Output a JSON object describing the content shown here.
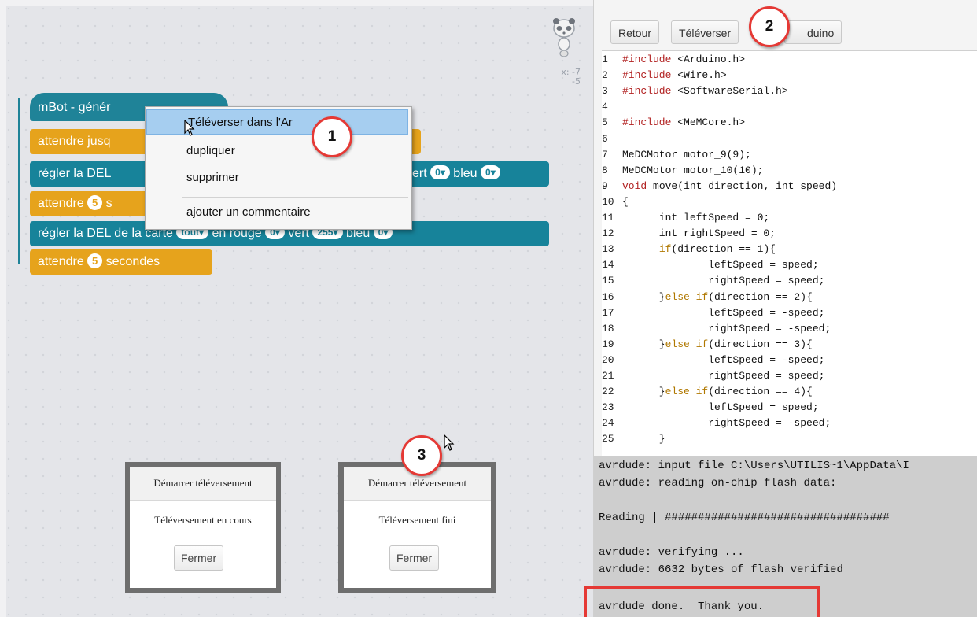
{
  "script_area": {
    "panda_icon": "panda-sprite",
    "coords": {
      "x": "x: -7",
      "y": "-5"
    },
    "blocks": {
      "hat": "mBot - génér",
      "hat_rest": "",
      "wait_until": "attendre jusq",
      "led1_prefix": "régler la DEL",
      "led1_green_label": "vert",
      "led1_green": "0",
      "led1_blue_label": "bleu",
      "led1_blue": "0",
      "wait1_prefix": "attendre",
      "wait1_num": "5",
      "wait1_suffix": "s",
      "led2_text": "régler la DEL de la carte",
      "led2_scope": "tout",
      "led2_red_label": "en rouge",
      "led2_red": "0",
      "led2_green_label": "vert",
      "led2_green": "255",
      "led2_blue_label": "bleu",
      "led2_blue": "0",
      "wait2_prefix": "attendre",
      "wait2_num": "5",
      "wait2_suffix": "secondes"
    },
    "context_menu": {
      "items": [
        "Téléverser dans l'Ar",
        "dupliquer",
        "supprimer",
        "ajouter un commentaire"
      ]
    },
    "dialogs": [
      {
        "title": "Démarrer téléversement",
        "message": "Téléversement en cours",
        "button": "Fermer"
      },
      {
        "title": "Démarrer téléversement",
        "message": "Téléversement fini",
        "button": "Fermer"
      }
    ],
    "callouts": [
      "1",
      "2",
      "3"
    ]
  },
  "code_panel": {
    "toolbar": {
      "back": "Retour",
      "upload": "Téléverser",
      "arduino": "duino"
    },
    "code_lines": [
      {
        "n": "1",
        "parts": [
          [
            "kw",
            "#include"
          ],
          [
            "t",
            " <Arduino.h>"
          ]
        ]
      },
      {
        "n": "2",
        "parts": [
          [
            "kw",
            "#include"
          ],
          [
            "t",
            " <Wire.h>"
          ]
        ]
      },
      {
        "n": "3",
        "parts": [
          [
            "kw",
            "#include"
          ],
          [
            "t",
            " <SoftwareSerial.h>"
          ]
        ]
      },
      {
        "n": "4",
        "parts": []
      },
      {
        "n": "5",
        "parts": [
          [
            "kw",
            "#include"
          ],
          [
            "t",
            " <MeMCore.h>"
          ]
        ]
      },
      {
        "n": "6",
        "parts": []
      },
      {
        "n": "7",
        "parts": [
          [
            "t",
            "MeDCMotor motor_9(9);"
          ]
        ]
      },
      {
        "n": "8",
        "parts": [
          [
            "t",
            "MeDCMotor motor_10(10);"
          ]
        ]
      },
      {
        "n": "9",
        "parts": [
          [
            "kw",
            "void"
          ],
          [
            "t",
            " move(int direction, int speed)"
          ]
        ]
      },
      {
        "n": "10",
        "parts": [
          [
            "t",
            "{"
          ]
        ]
      },
      {
        "n": "11",
        "parts": [
          [
            "t",
            "      int leftSpeed = 0;"
          ]
        ]
      },
      {
        "n": "12",
        "parts": [
          [
            "t",
            "      int rightSpeed = 0;"
          ]
        ]
      },
      {
        "n": "13",
        "parts": [
          [
            "t",
            "      "
          ],
          [
            "kw2",
            "if"
          ],
          [
            "t",
            "(direction == 1){"
          ]
        ]
      },
      {
        "n": "14",
        "parts": [
          [
            "t",
            "              leftSpeed = speed;"
          ]
        ]
      },
      {
        "n": "15",
        "parts": [
          [
            "t",
            "              rightSpeed = speed;"
          ]
        ]
      },
      {
        "n": "16",
        "parts": [
          [
            "t",
            "      }"
          ],
          [
            "kw2",
            "else if"
          ],
          [
            "t",
            "(direction == 2){"
          ]
        ]
      },
      {
        "n": "17",
        "parts": [
          [
            "t",
            "              leftSpeed = -speed;"
          ]
        ]
      },
      {
        "n": "18",
        "parts": [
          [
            "t",
            "              rightSpeed = -speed;"
          ]
        ]
      },
      {
        "n": "19",
        "parts": [
          [
            "t",
            "      }"
          ],
          [
            "kw2",
            "else if"
          ],
          [
            "t",
            "(direction == 3){"
          ]
        ]
      },
      {
        "n": "20",
        "parts": [
          [
            "t",
            "              leftSpeed = -speed;"
          ]
        ]
      },
      {
        "n": "21",
        "parts": [
          [
            "t",
            "              rightSpeed = speed;"
          ]
        ]
      },
      {
        "n": "22",
        "parts": [
          [
            "t",
            "      }"
          ],
          [
            "kw2",
            "else if"
          ],
          [
            "t",
            "(direction == 4){"
          ]
        ]
      },
      {
        "n": "23",
        "parts": [
          [
            "t",
            "              leftSpeed = speed;"
          ]
        ]
      },
      {
        "n": "24",
        "parts": [
          [
            "t",
            "              rightSpeed = -speed;"
          ]
        ]
      },
      {
        "n": "25",
        "parts": [
          [
            "t",
            "      }"
          ]
        ]
      }
    ],
    "console_lines": [
      "avrdude: input file C:\\Users\\UTILIS~1\\AppData\\I",
      "avrdude: reading on-chip flash data:",
      "",
      "Reading | ##################################",
      "",
      "avrdude: verifying ...",
      "avrdude: 6632 bytes of flash verified",
      "",
      "avrdude done.  Thank you."
    ]
  },
  "colors": {
    "block_teal": "#17839a",
    "block_orange": "#e6a31c",
    "callout_red": "#e53935",
    "menu_highlight": "#a6cef0"
  }
}
